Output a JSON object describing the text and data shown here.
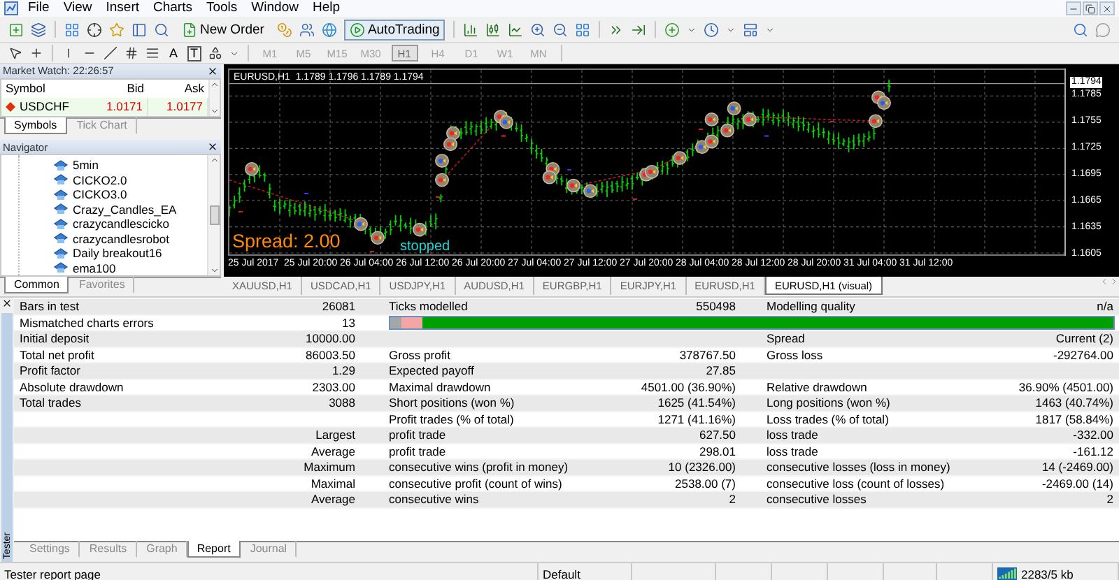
{
  "menu": [
    "File",
    "View",
    "Insert",
    "Charts",
    "Tools",
    "Window",
    "Help"
  ],
  "toolbar": {
    "new_order": "New Order",
    "autotrading": {
      "label": "AutoTrading",
      "on": true
    },
    "text_tools": [
      "A",
      "T"
    ]
  },
  "timeframes": [
    {
      "label": "M1",
      "selected": false
    },
    {
      "label": "M5",
      "selected": false
    },
    {
      "label": "M15",
      "selected": false
    },
    {
      "label": "M30",
      "selected": false
    },
    {
      "label": "H1",
      "selected": true
    },
    {
      "label": "H4",
      "selected": false
    },
    {
      "label": "D1",
      "selected": false
    },
    {
      "label": "W1",
      "selected": false
    },
    {
      "label": "MN",
      "selected": false
    }
  ],
  "market_watch": {
    "title": "Market Watch: 22:26:57",
    "columns": [
      "Symbol",
      "Bid",
      "Ask"
    ],
    "rows": [
      {
        "symbol": "USDCHF",
        "bid": "1.0171",
        "ask": "1.0177"
      }
    ],
    "tabs": [
      {
        "label": "Symbols",
        "selected": true
      },
      {
        "label": "Tick Chart",
        "selected": false
      }
    ]
  },
  "navigator": {
    "title": "Navigator",
    "items": [
      "5min",
      "CICKO2.0",
      "CICKO3.0",
      "Crazy_Candles_EA",
      "crazycandlescicko",
      "crazycandlesrobot",
      "Daily breakout16",
      "ema100"
    ],
    "tabs": [
      {
        "label": "Common",
        "selected": true
      },
      {
        "label": "Favorites",
        "selected": false
      }
    ]
  },
  "chart": {
    "header": "EURUSD,H1  1.1789 1.1796 1.1789 1.1794",
    "current_price": "1.1794",
    "price_labels": [
      "1.1785",
      "1.1755",
      "1.1725",
      "1.1695",
      "1.1665",
      "1.1635",
      "1.1605"
    ],
    "time_labels": [
      "25 Jul 2017",
      "25 Jul 20:00",
      "26 Jul 04:00",
      "26 Jul 12:00",
      "26 Jul 20:00",
      "27 Jul 04:00",
      "27 Jul 12:00",
      "27 Jul 20:00",
      "28 Jul 04:00",
      "28 Jul 12:00",
      "28 Jul 20:00",
      "31 Jul 04:00",
      "31 Jul 12:00"
    ],
    "spread": "Spread: 2.00",
    "status": "stopped"
  },
  "chart_tabs": [
    {
      "label": "XAUUSD,H1",
      "selected": false
    },
    {
      "label": "USDCAD,H1",
      "selected": false
    },
    {
      "label": "USDJPY,H1",
      "selected": false
    },
    {
      "label": "AUDUSD,H1",
      "selected": false
    },
    {
      "label": "EURGBP,H1",
      "selected": false
    },
    {
      "label": "EURJPY,H1",
      "selected": false
    },
    {
      "label": "EURUSD,H1",
      "selected": false
    },
    {
      "label": "EURUSD,H1 (visual)",
      "selected": true
    }
  ],
  "report": {
    "rows": [
      {
        "left": {
          "label": "Bars in test",
          "value": "26081"
        },
        "middle": {
          "label": "Ticks modelled",
          "value": "550498"
        },
        "right": {
          "label": "Modelling quality",
          "value": "n/a"
        }
      },
      {
        "kind": "quality",
        "left": {
          "label": "Mismatched charts errors",
          "value": "13"
        },
        "quality_bar": [
          {
            "color": "#a6a6a6",
            "level": 0.015
          },
          {
            "color": "#f4a6a6",
            "level": 0.045
          },
          {
            "color": "#00a000",
            "level": 1
          }
        ]
      },
      {
        "left": {
          "label": "Initial deposit",
          "value": "10000.00"
        },
        "right": {
          "label": "Spread",
          "value": "Current (2)"
        }
      },
      {
        "left": {
          "label": "Total net profit",
          "value": "86003.50"
        },
        "middle": {
          "label": "Gross profit",
          "value": "378767.50"
        },
        "right": {
          "label": "Gross loss",
          "value": "-292764.00"
        }
      },
      {
        "left": {
          "label": "Profit factor",
          "value": "1.29"
        },
        "middle": {
          "label": "Expected payoff",
          "value": "27.85"
        }
      },
      {
        "left": {
          "label": "Absolute drawdown",
          "value": "2303.00"
        },
        "middle": {
          "label": "Maximal drawdown",
          "value": "4501.00 (36.90%)"
        },
        "right": {
          "label": "Relative drawdown",
          "value": "36.90% (4501.00)"
        }
      },
      {
        "left": {
          "label": "Total trades",
          "value": "3088"
        },
        "middle": {
          "label": "Short positions (won %)",
          "value": "1625 (41.54%)"
        },
        "right": {
          "label": "Long positions (won %)",
          "value": "1463 (40.74%)"
        }
      },
      {
        "middle": {
          "label": "Profit trades (% of total)",
          "value": "1271 (41.16%)"
        },
        "right": {
          "label": "Loss trades (% of total)",
          "value": "1817 (58.84%)"
        }
      },
      {
        "left": {
          "value": "Largest"
        },
        "middle": {
          "label": "profit trade",
          "value": "627.50"
        },
        "right": {
          "label": "loss trade",
          "value": "-332.00"
        }
      },
      {
        "left": {
          "value": "Average"
        },
        "middle": {
          "label": "profit trade",
          "value": "298.01"
        },
        "right": {
          "label": "loss trade",
          "value": "-161.12"
        }
      },
      {
        "left": {
          "value": "Maximum"
        },
        "middle": {
          "label": "consecutive wins (profit in money)",
          "value": "10 (2326.00)"
        },
        "right": {
          "label": "consecutive losses (loss in money)",
          "value": "14 (-2469.00)"
        }
      },
      {
        "left": {
          "value": "Maximal"
        },
        "middle": {
          "label": "consecutive profit (count of wins)",
          "value": "2538.00 (7)"
        },
        "right": {
          "label": "consecutive loss (count of losses)",
          "value": "-2469.00 (14)"
        }
      },
      {
        "left": {
          "value": "Average"
        },
        "middle": {
          "label": "consecutive wins",
          "value": "2"
        },
        "right": {
          "label": "consecutive losses",
          "value": "2"
        }
      }
    ]
  },
  "tester": {
    "title": "Tester",
    "tabs": [
      {
        "label": "Settings",
        "selected": false
      },
      {
        "label": "Results",
        "selected": false
      },
      {
        "label": "Graph",
        "selected": false
      },
      {
        "label": "Report",
        "selected": true
      },
      {
        "label": "Journal",
        "selected": false
      }
    ]
  },
  "status_bar": {
    "message": "Tester report page",
    "profile": "Default",
    "traffic": "2283/5 kb"
  }
}
